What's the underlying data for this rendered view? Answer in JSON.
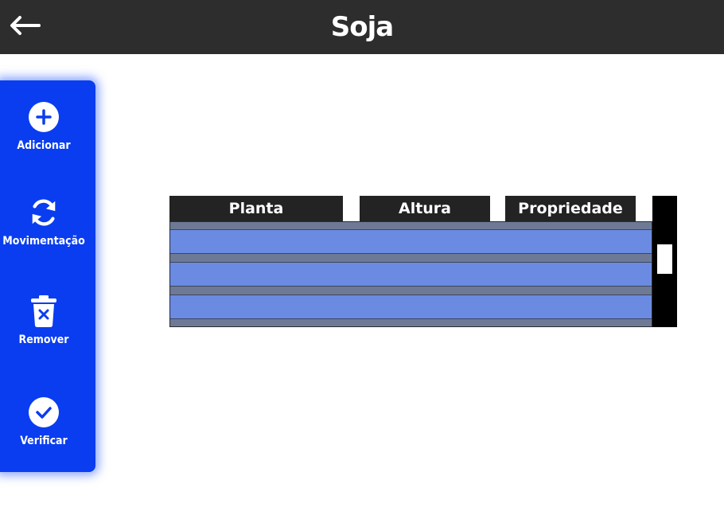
{
  "header": {
    "title": "Soja",
    "back_icon": "arrow-left-icon"
  },
  "sidebar": {
    "accent_color": "#0a3df0",
    "items": [
      {
        "label": "Adicionar",
        "icon": "plus-circle-icon"
      },
      {
        "label": "Movimentação",
        "icon": "refresh-icon"
      },
      {
        "label": "Remover",
        "icon": "trash-x-icon"
      },
      {
        "label": "Verificar",
        "icon": "check-circle-icon"
      }
    ]
  },
  "table": {
    "columns": [
      "Planta",
      "Altura",
      "Propriedade"
    ],
    "rows": [
      [
        "",
        "",
        ""
      ],
      [
        "",
        "",
        ""
      ],
      [
        "",
        "",
        ""
      ]
    ]
  }
}
